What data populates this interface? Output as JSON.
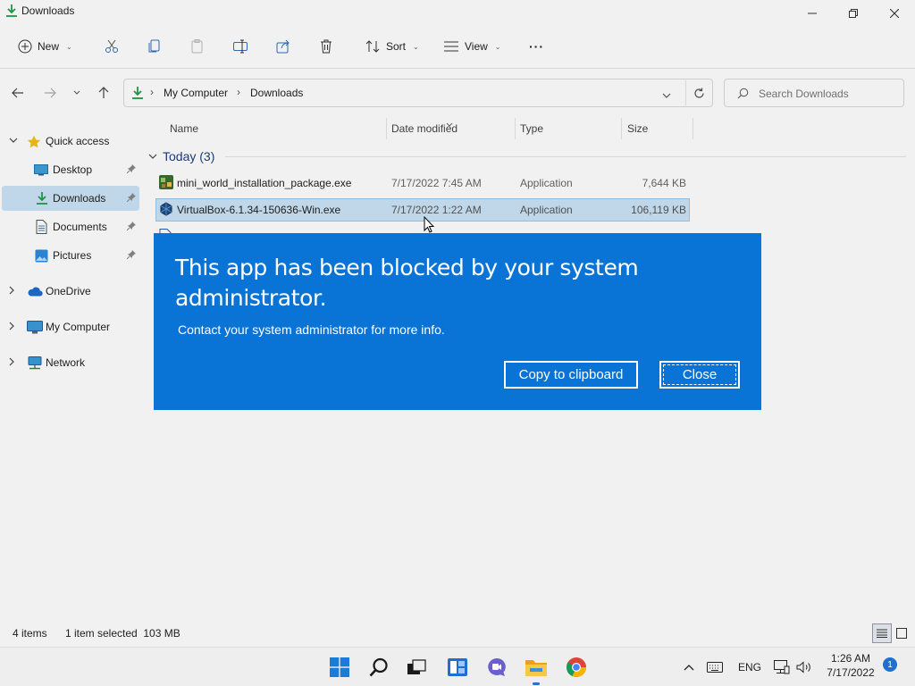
{
  "window": {
    "title": "Downloads"
  },
  "toolbar": {
    "new_label": "New",
    "sort_label": "Sort",
    "view_label": "View",
    "more_label": "···"
  },
  "address": {
    "crumbs": [
      "My Computer",
      "Downloads"
    ]
  },
  "search": {
    "placeholder": "Search Downloads"
  },
  "sidebar": {
    "items": [
      {
        "label": "Quick access",
        "icon": "star-icon"
      },
      {
        "label": "Desktop",
        "icon": "desktop-icon",
        "pinned": true
      },
      {
        "label": "Downloads",
        "icon": "download-icon",
        "pinned": true,
        "selected": true
      },
      {
        "label": "Documents",
        "icon": "documents-icon",
        "pinned": true
      },
      {
        "label": "Pictures",
        "icon": "pictures-icon",
        "pinned": true
      },
      {
        "label": "OneDrive",
        "icon": "cloud-icon"
      },
      {
        "label": "My Computer",
        "icon": "computer-icon"
      },
      {
        "label": "Network",
        "icon": "network-icon"
      }
    ]
  },
  "filelist": {
    "columns": [
      "Name",
      "Date modified",
      "Type",
      "Size"
    ],
    "group": "Today (3)",
    "rows": [
      {
        "name": "mini_world_installation_package.exe",
        "date": "7/17/2022 7:45 AM",
        "type": "Application",
        "size": "7,644 KB"
      },
      {
        "name": "VirtualBox-6.1.34-150636-Win.exe",
        "date": "7/17/2022 1:22 AM",
        "type": "Application",
        "size": "106,119 KB",
        "selected": true
      }
    ]
  },
  "status": {
    "items": "4 items",
    "selection": "1 item selected  103 MB"
  },
  "dialog": {
    "heading": "This app has been blocked by your system administrator.",
    "message": "Contact your system administrator for more info.",
    "copy_label": "Copy to clipboard",
    "close_label": "Close"
  },
  "taskbar": {
    "apps": [
      "start-icon",
      "search-icon",
      "task-view-icon",
      "widgets-icon",
      "chat-icon",
      "file-explorer-icon",
      "chrome-icon"
    ],
    "language": "ENG",
    "time": "1:26 AM",
    "date": "7/17/2022",
    "notification_count": "1"
  },
  "colors": {
    "dialog_bg": "#0a74d6",
    "selection": "#cce4f7",
    "accent": "#1f6fd0"
  }
}
